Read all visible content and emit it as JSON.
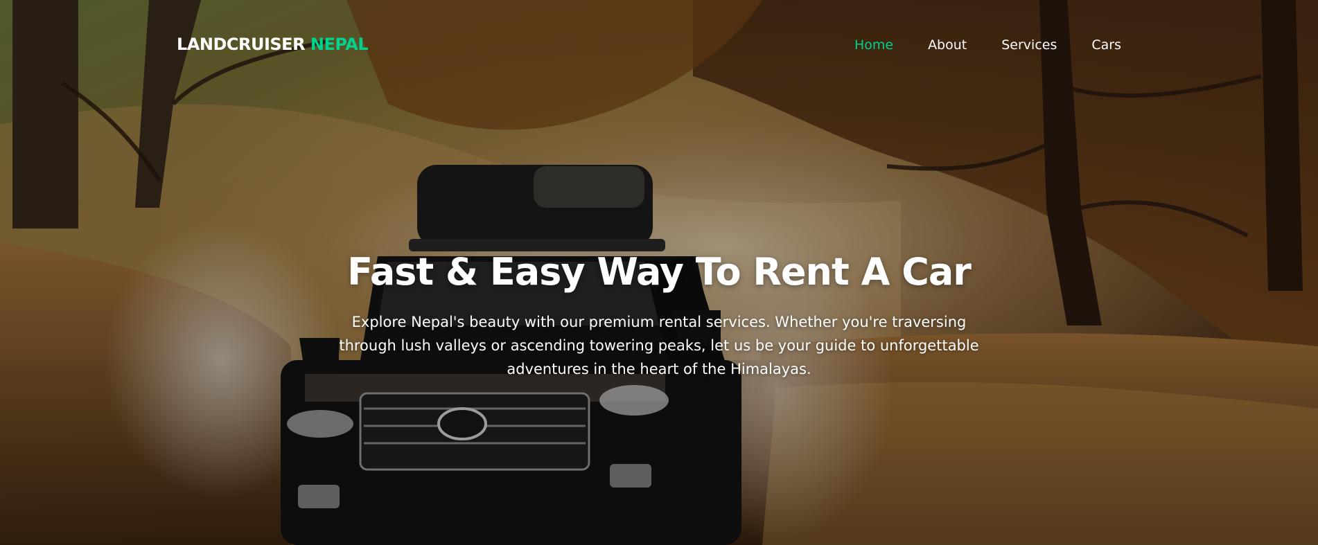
{
  "brand": {
    "name_main": "LANDCRUISER",
    "name_accent": "NEPAL",
    "accent_color": "#01d28e"
  },
  "nav": {
    "items": [
      {
        "label": "Home",
        "active": true
      },
      {
        "label": "About",
        "active": false
      },
      {
        "label": "Services",
        "active": false
      },
      {
        "label": "Cars",
        "active": false
      }
    ]
  },
  "hero": {
    "title": "Fast & Easy Way To Rent A Car",
    "description": "Explore Nepal's beauty with our premium rental services. Whether you're traversing through lush valleys or ascending towering peaks, let us be your guide to unforgettable adventures in the heart of the Himalayas.",
    "background": "forest-trail-land-cruiser-photo"
  }
}
